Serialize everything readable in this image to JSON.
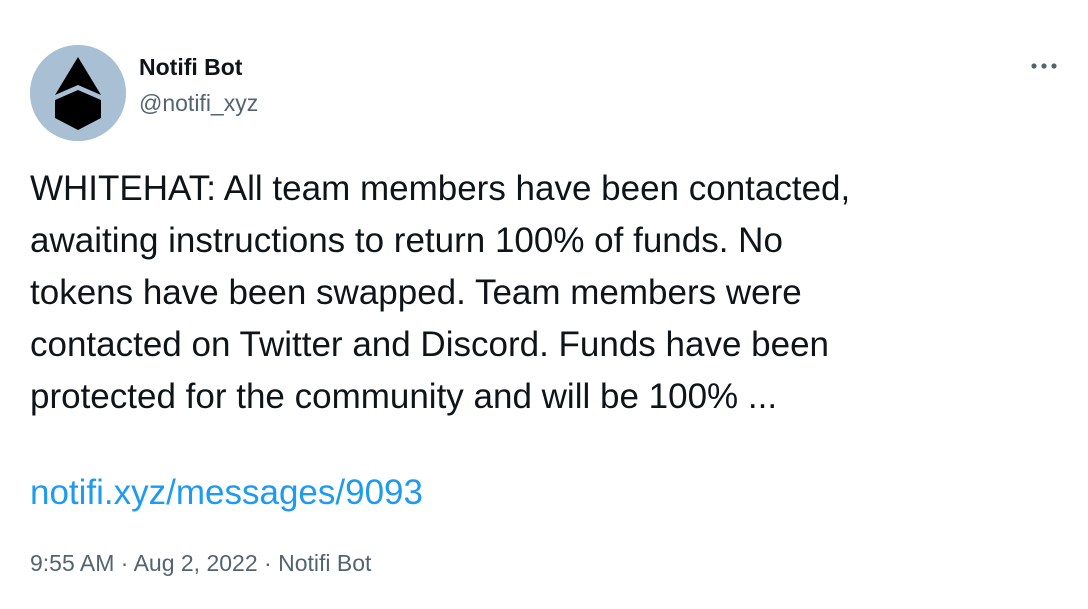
{
  "author": {
    "display_name": "Notifi Bot",
    "handle": "@notifi_xyz",
    "avatar_icon": "notifi-logo-icon",
    "avatar_bg": "#a9c0d4"
  },
  "more_icon": "more-horizontal-icon",
  "tweet": {
    "text": "WHITEHAT: All team members have been contacted,\nawaiting instructions to return 100% of funds. No\ntokens have been swapped. Team members were\ncontacted on Twitter and Discord. Funds have been\nprotected for the community and will be 100% ...",
    "link": "notifi.xyz/messages/9093"
  },
  "meta": {
    "time": "9:55 AM",
    "separator": "·",
    "date": "Aug 2, 2022",
    "source": "Notifi Bot"
  },
  "colors": {
    "text": "#0f1419",
    "secondary": "#536471",
    "link": "#1d9bf0"
  }
}
